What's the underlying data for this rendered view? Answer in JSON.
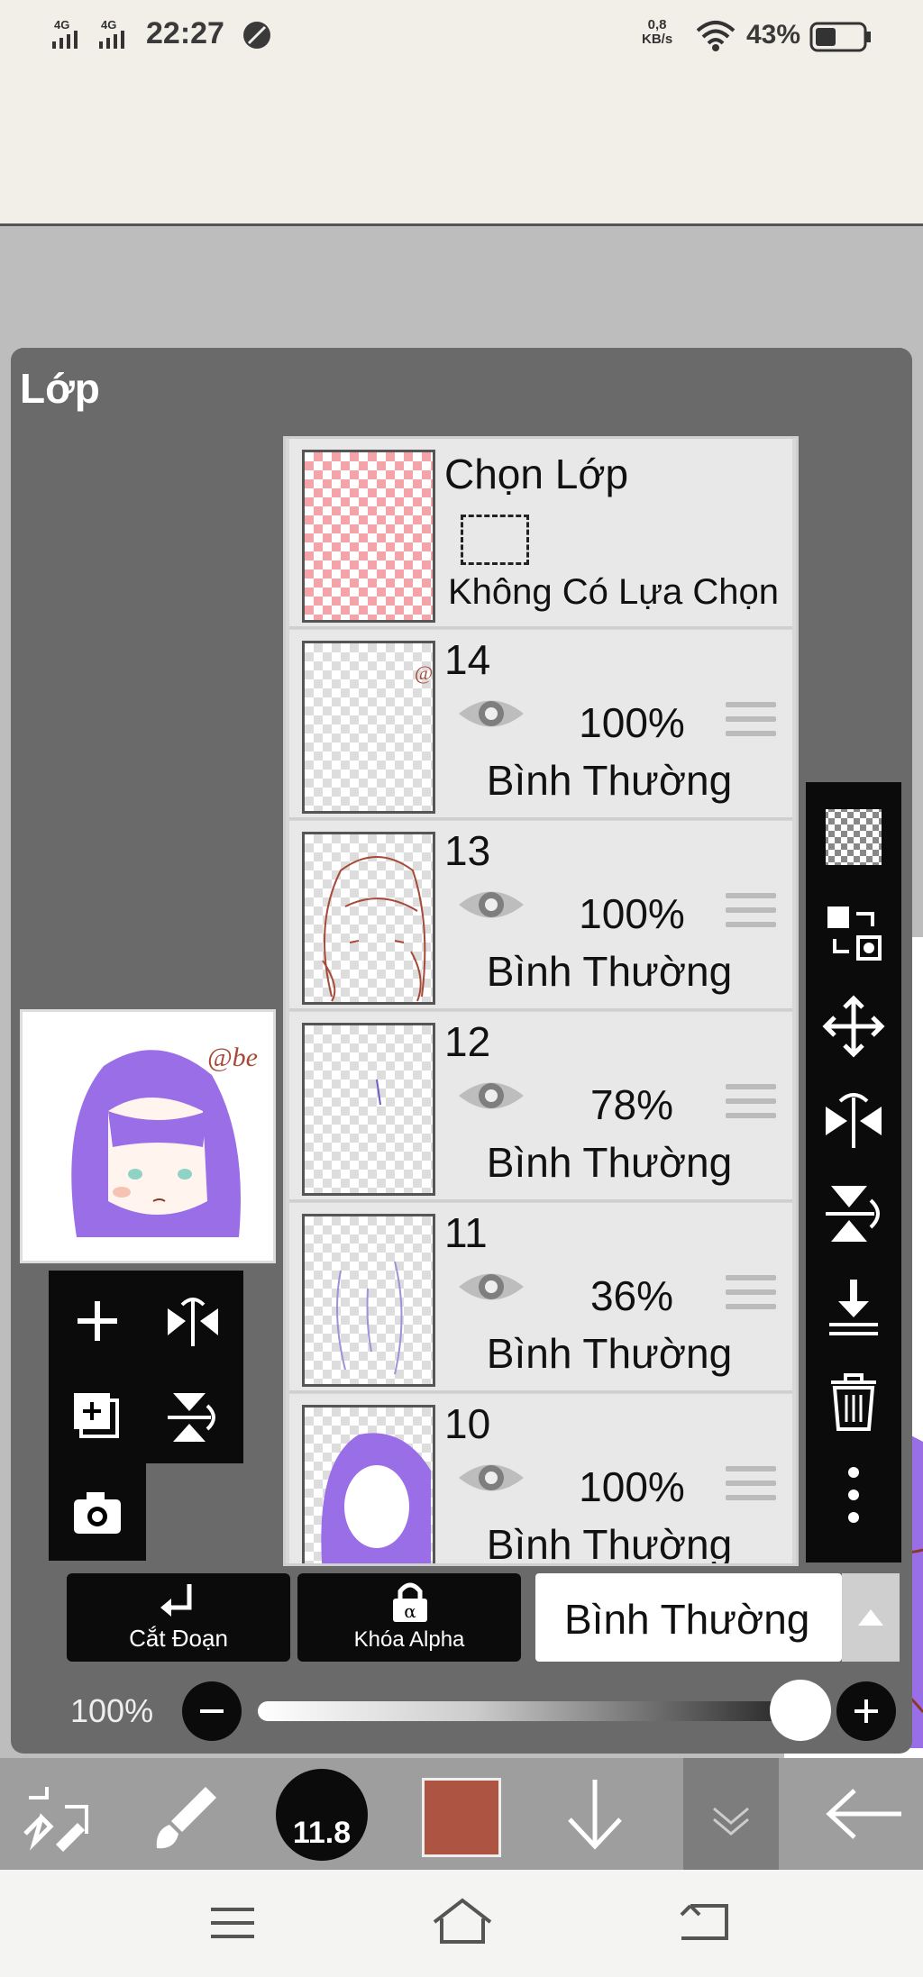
{
  "status_bar": {
    "network_1": "4G",
    "network_2": "4G",
    "time": "22:27",
    "speed_value": "0,8",
    "speed_unit": "KB/s",
    "battery": "43%"
  },
  "panel": {
    "title": "Lớp"
  },
  "selection_layer": {
    "title": "Chọn Lớp",
    "subtitle": "Không Có Lựa Chọn"
  },
  "layers": [
    {
      "number": "14",
      "opacity": "100%",
      "blend": "Bình Thường"
    },
    {
      "number": "13",
      "opacity": "100%",
      "blend": "Bình Thường"
    },
    {
      "number": "12",
      "opacity": "78%",
      "blend": "Bình Thường"
    },
    {
      "number": "11",
      "opacity": "36%",
      "blend": "Bình Thường"
    },
    {
      "number": "10",
      "opacity": "100%",
      "blend": "Bình Thường"
    }
  ],
  "buttons": {
    "clipping": "Cắt Đoạn",
    "alpha_lock": "Khóa Alpha",
    "blend_mode": "Bình Thường"
  },
  "opacity": {
    "label": "100%",
    "value": 1.0
  },
  "brush_size": "11.8",
  "colors": {
    "current_color": "#ad5442",
    "panel_bg": "#6a6a6a",
    "toolbar_bg": "#0b0b0b",
    "hair_purple": "#9a6ee6"
  },
  "icons": {
    "right_toolbar": [
      "transparency-icon",
      "swap-layer-icon",
      "move-icon",
      "flip-horizontal-icon",
      "flip-vertical-icon",
      "merge-down-icon",
      "trash-icon",
      "more-icon"
    ],
    "bottom_toolbar": [
      "transform-icon",
      "brush-icon",
      "brush-size-icon",
      "color-icon",
      "arrow-down-icon",
      "layer-icon",
      "back-icon"
    ],
    "nav": [
      "menu-icon",
      "home-icon",
      "back-nav-icon"
    ]
  }
}
